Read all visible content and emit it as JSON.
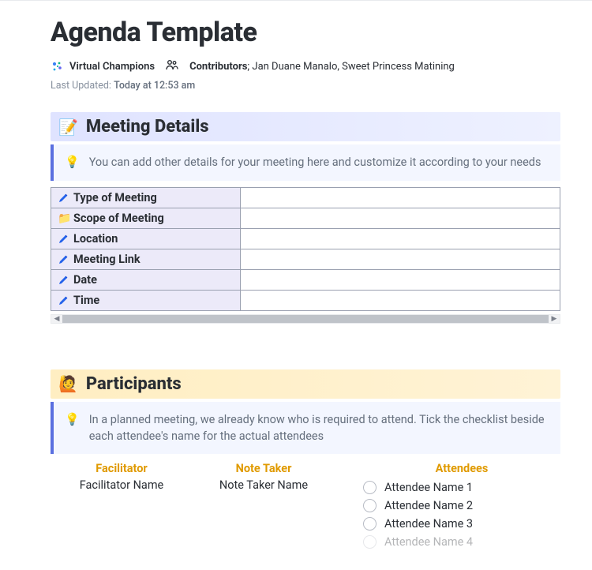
{
  "header": {
    "title": "Agenda Template",
    "org_name": "Virtual Champions",
    "contributors_label": "Contributors",
    "contributors_names": "Jan Duane Manalo, Sweet Princess Matining",
    "updated_label": "Last Updated:",
    "updated_value": "Today at 12:53 am"
  },
  "meeting_details": {
    "heading": "Meeting Details",
    "tip": "You can add other details for your meeting here and customize it according to your needs",
    "rows": [
      {
        "label": "Type of Meeting",
        "value": "",
        "icon": "pencil"
      },
      {
        "label": "Scope of Meeting",
        "value": "",
        "icon": "folder"
      },
      {
        "label": "Location",
        "value": "",
        "icon": "pencil"
      },
      {
        "label": "Meeting Link",
        "value": "",
        "icon": "pencil"
      },
      {
        "label": "Date",
        "value": "",
        "icon": "pencil"
      },
      {
        "label": "Time",
        "value": "",
        "icon": "pencil"
      }
    ]
  },
  "participants": {
    "heading": "Participants",
    "tip": "In a planned meeting, we already know who is required to attend. Tick the checklist beside each attendee's name for the actual attendees",
    "facilitator_head": "Facilitator",
    "facilitator_name": "Facilitator Name",
    "notetaker_head": "Note Taker",
    "notetaker_name": "Note Taker Name",
    "attendees_head": "Attendees",
    "attendees": [
      "Attendee Name 1",
      "Attendee Name 2",
      "Attendee Name 3",
      "Attendee Name 4"
    ]
  }
}
